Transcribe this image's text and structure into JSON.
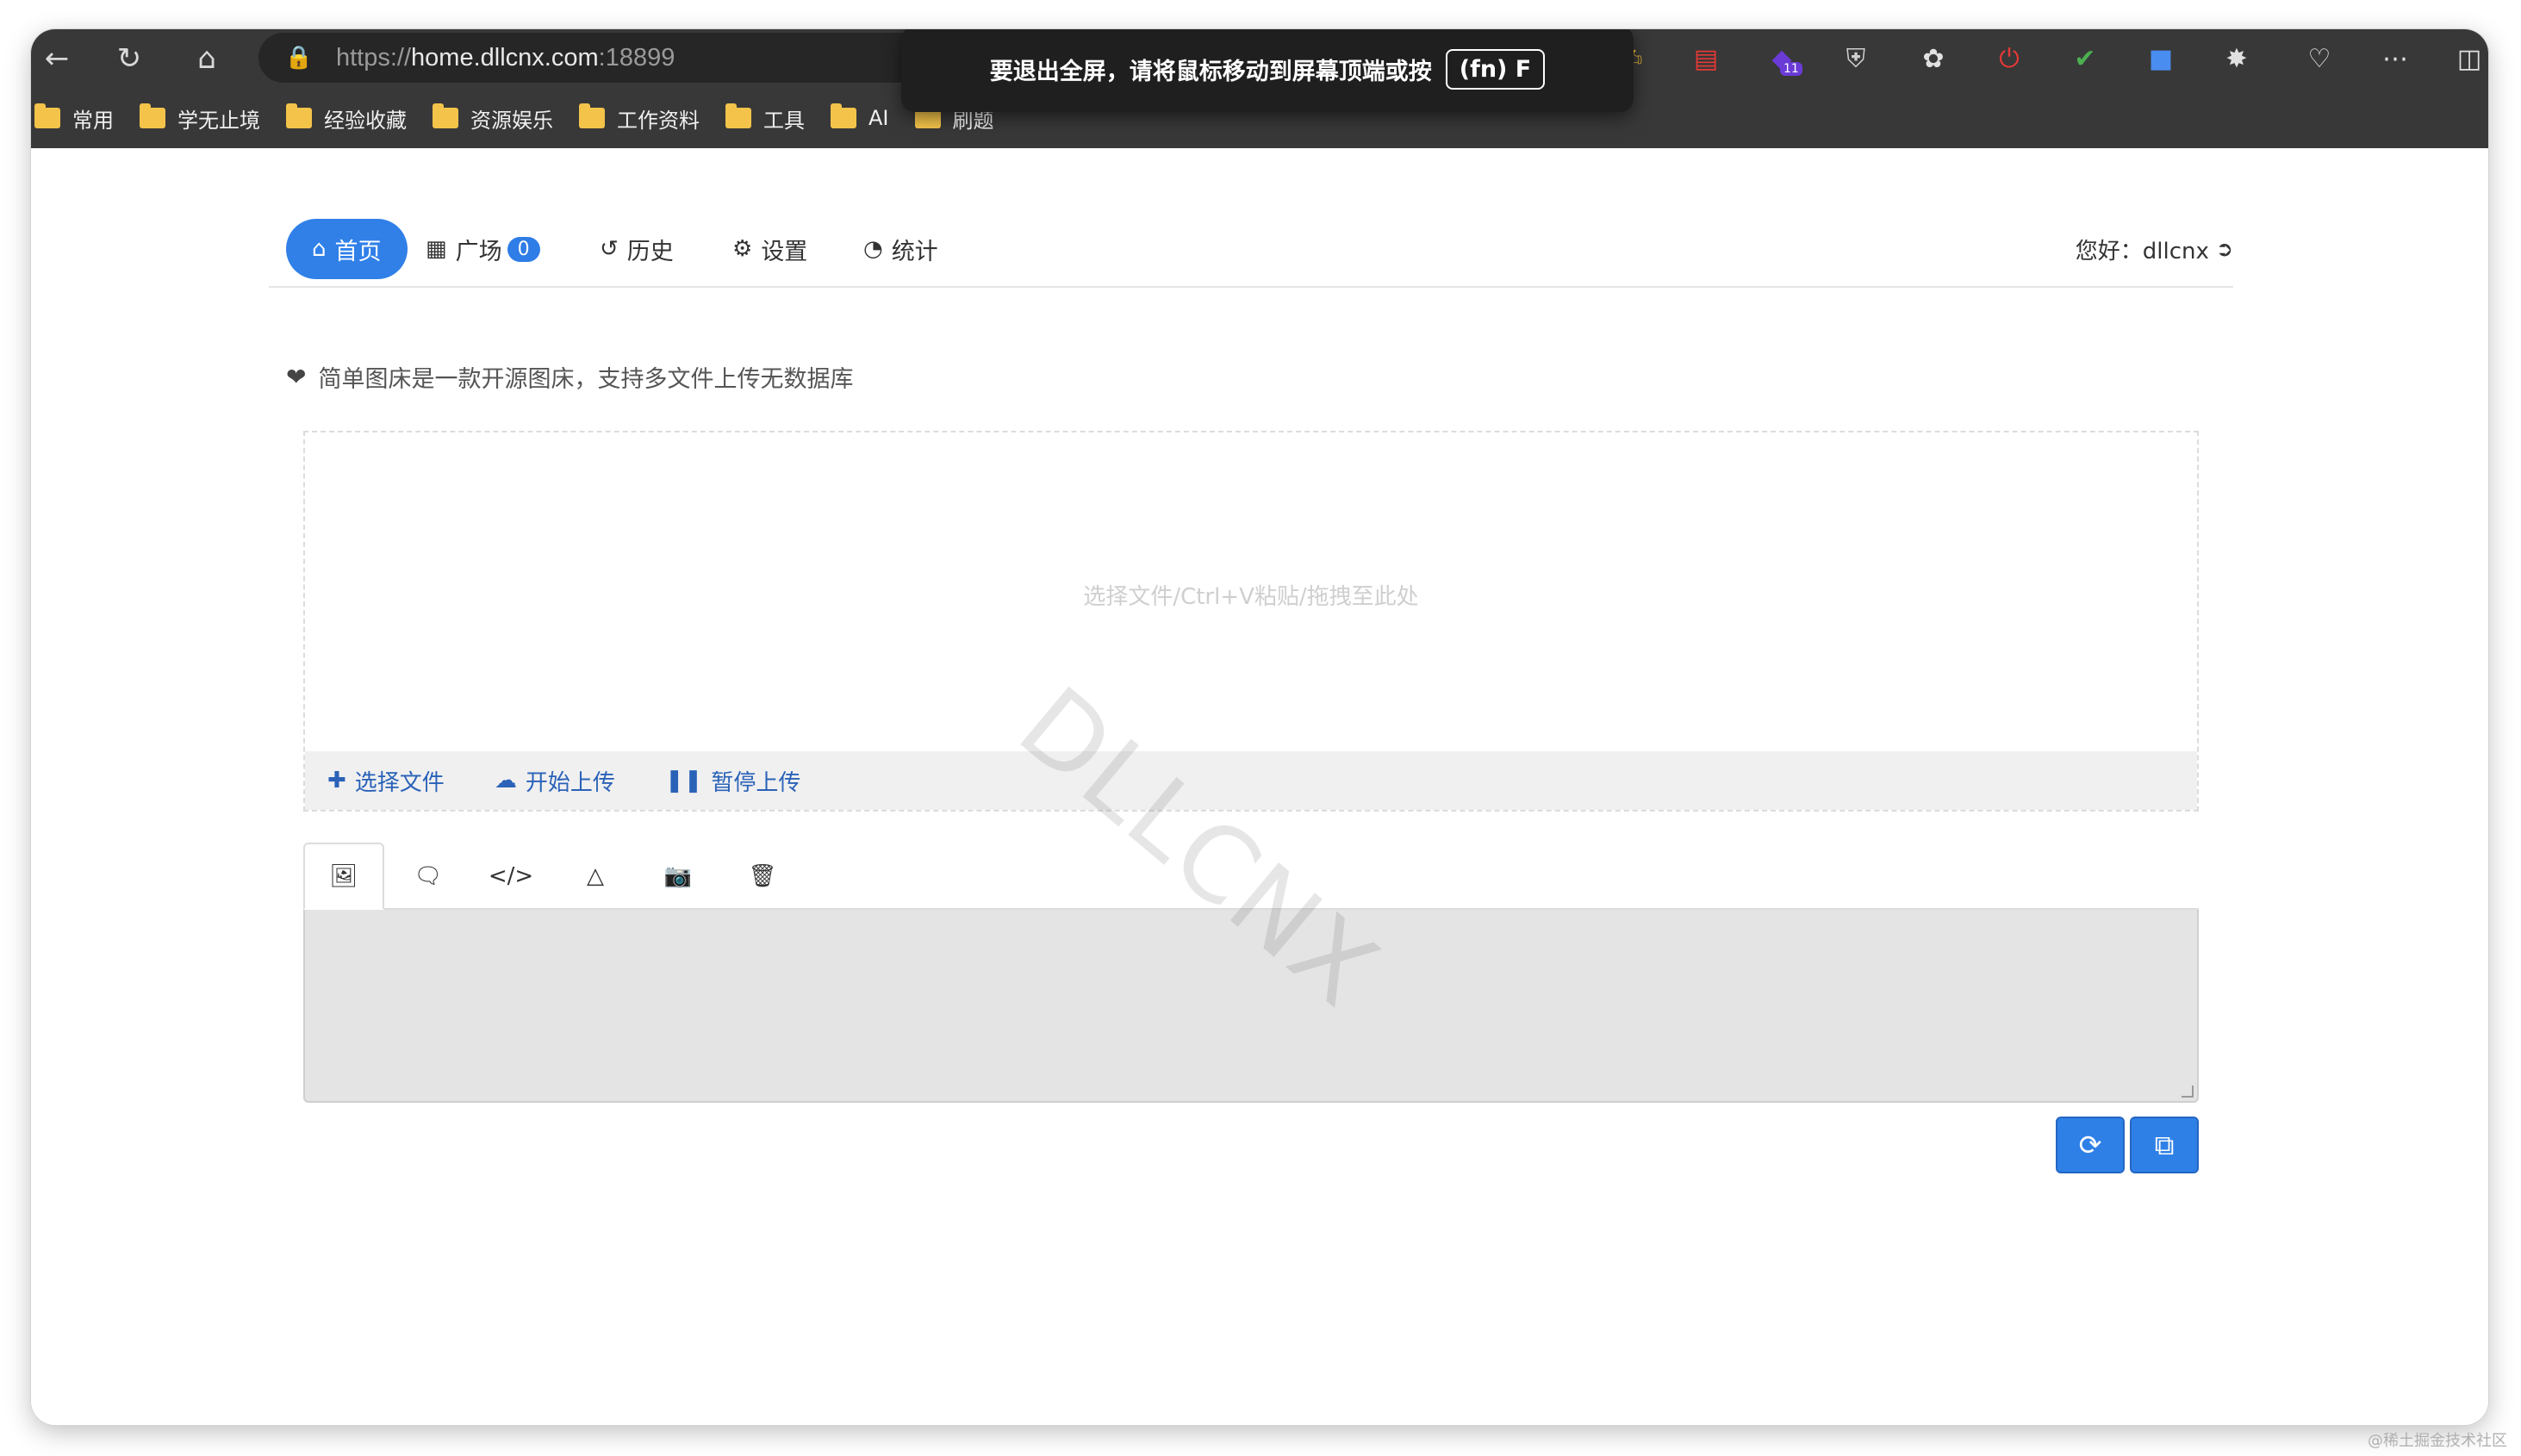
{
  "browser": {
    "url_prefix": "https://",
    "url_host": "home.dllcnx.com",
    "url_port": ":18899",
    "back_icon": "arrow-left-icon",
    "reload_icon": "reload-icon",
    "home_icon": "home-icon",
    "extension_badge": "11",
    "bookmarks": [
      "常用",
      "学无止境",
      "经验收藏",
      "资源娱乐",
      "工作资料",
      "工具",
      "AI",
      "刷题"
    ],
    "fullscreen_toast": {
      "message": "要退出全屏，请将鼠标移动到屏幕顶端或按",
      "key": "(fn) F"
    }
  },
  "nav": {
    "items": [
      {
        "label": "首页",
        "icon": "home-icon"
      },
      {
        "label": "广场",
        "icon": "grid-icon",
        "badge": "0"
      },
      {
        "label": "历史",
        "icon": "history-icon"
      },
      {
        "label": "设置",
        "icon": "gears-icon"
      },
      {
        "label": "统计",
        "icon": "pie-chart-icon"
      }
    ],
    "greeting": "您好：dllcnx",
    "logout_icon": "sign-out-icon"
  },
  "tagline": {
    "icon": "heart-icon",
    "text": "简单图床是一款开源图床，支持多文件上传无数据库"
  },
  "upload": {
    "hint": "选择文件/Ctrl+V粘贴/拖拽至此处",
    "select_label": "选择文件",
    "start_label": "开始上传",
    "pause_label": "暂停上传"
  },
  "watermark": "DLLCNX",
  "output_tabs": [
    {
      "icon": "image-icon"
    },
    {
      "icon": "comment-icon"
    },
    {
      "icon": "code-icon"
    },
    {
      "icon": "html5-icon"
    },
    {
      "icon": "camera-icon"
    },
    {
      "icon": "trash-icon"
    }
  ],
  "actions": {
    "refresh_icon": "refresh-icon",
    "copy_icon": "copy-icon"
  },
  "credit": "@稀土掘金技术社区",
  "colors": {
    "primary": "#3080e8",
    "link": "#2a62b8",
    "chrome": "#383838"
  }
}
